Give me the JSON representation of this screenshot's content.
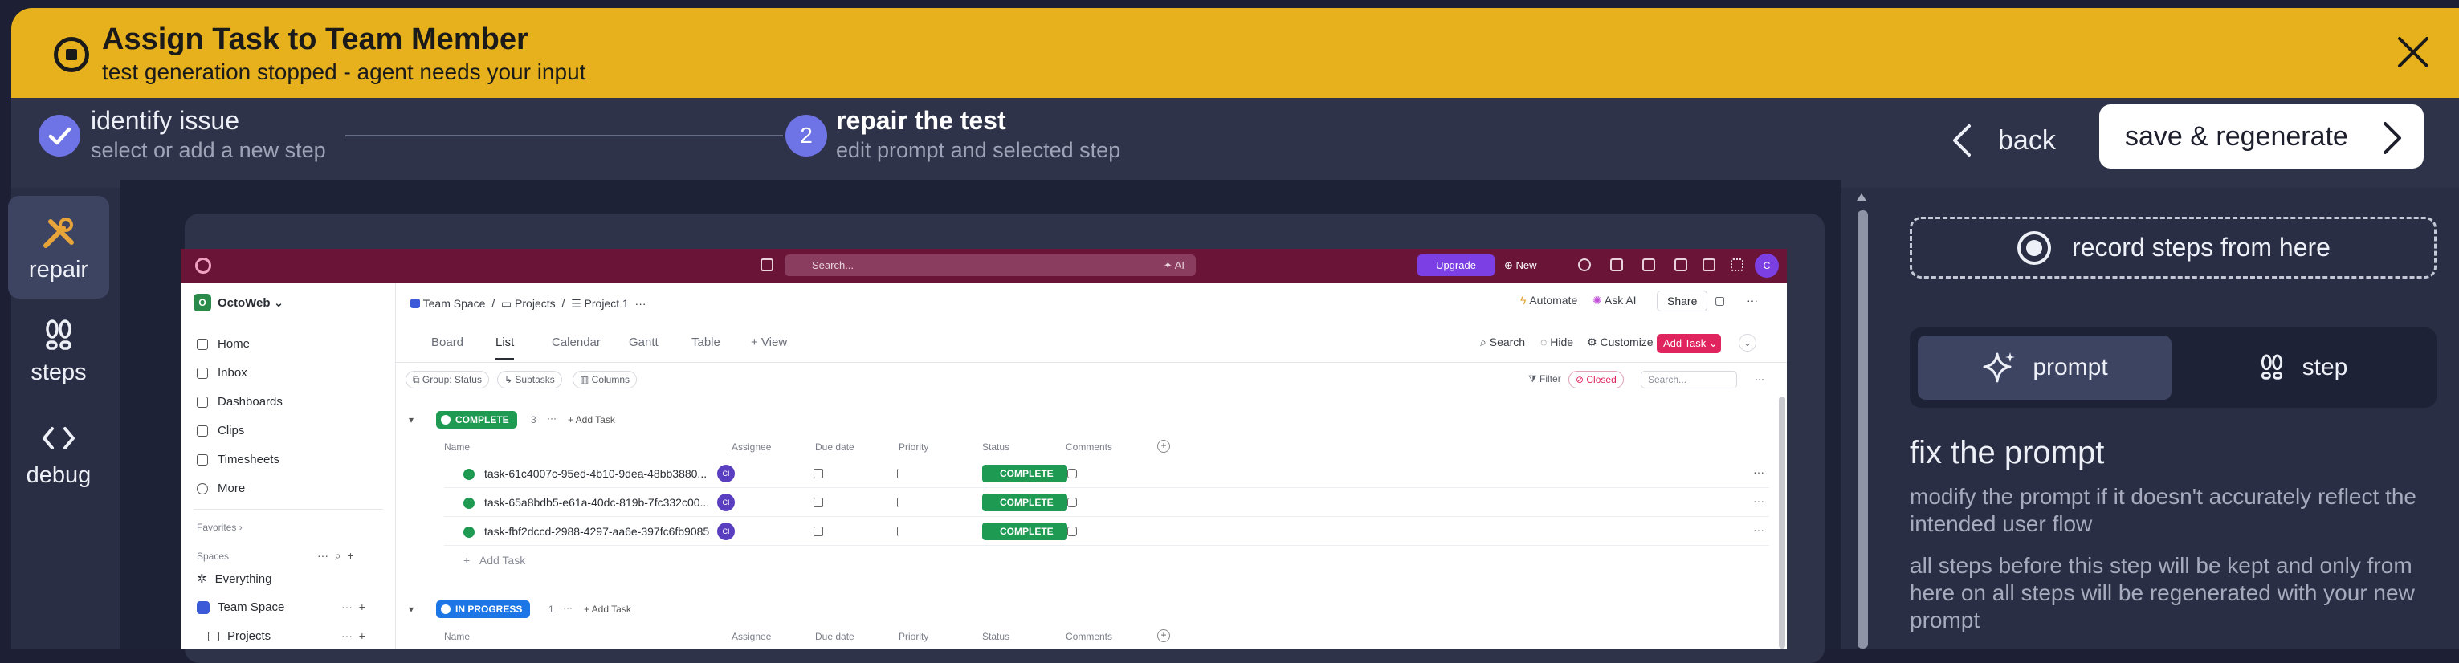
{
  "banner": {
    "title": "Assign Task to Team Member",
    "subtitle": "test generation stopped - agent needs your input"
  },
  "steps": {
    "step1": {
      "title": "identify issue",
      "subtitle": "select or add a new step"
    },
    "step2": {
      "number": "2",
      "title": "repair the test",
      "subtitle": "edit prompt and selected step"
    },
    "back_label": "back",
    "save_label": "save & regenerate"
  },
  "rail": {
    "items": [
      {
        "label": "repair",
        "active": true
      },
      {
        "label": "steps"
      },
      {
        "label": "debug"
      }
    ]
  },
  "preview": {
    "topbar": {
      "search": "Search...",
      "ai": "AI",
      "upgrade": "Upgrade",
      "new": "New",
      "avatar": "C"
    },
    "sidebar": {
      "workspace_badge": "O",
      "workspace": "OctoWeb",
      "nav": [
        "Home",
        "Inbox",
        "Dashboards",
        "Clips",
        "Timesheets",
        "More"
      ],
      "favorites": "Favorites",
      "spaces": "Spaces",
      "everything": "Everything",
      "team_space": "Team Space",
      "projects": "Projects"
    },
    "header": {
      "crumb1": "Team Space",
      "crumb2": "Projects",
      "crumb3": "Project 1",
      "automate": "Automate",
      "ask_ai": "Ask AI",
      "share": "Share"
    },
    "tabs": [
      "Board",
      "List",
      "Calendar",
      "Gantt",
      "Table",
      "+ View"
    ],
    "tools": {
      "search": "Search",
      "hide": "Hide",
      "customize": "Customize",
      "add_task": "Add Task"
    },
    "filters": {
      "group": "Group: Status",
      "subtasks": "Subtasks",
      "columns": "Columns",
      "filter": "Filter",
      "closed": "Closed",
      "search": "Search..."
    },
    "columns": [
      "Name",
      "Assignee",
      "Due date",
      "Priority",
      "Status",
      "Comments"
    ],
    "groups": [
      {
        "label": "COMPLETE",
        "count": "3",
        "add": "+ Add Task",
        "tasks": [
          {
            "name": "task-61c4007c-95ed-4b10-9dea-48bb3880...",
            "assignee": "CI",
            "status": "COMPLETE"
          },
          {
            "name": "task-65a8bdb5-e61a-40dc-819b-7fc332c00...",
            "assignee": "CI",
            "status": "COMPLETE"
          },
          {
            "name": "task-fbf2dccd-2988-4297-aa6e-397fc6fb9085",
            "assignee": "CI",
            "status": "COMPLETE"
          }
        ],
        "add_row": "Add Task"
      },
      {
        "label": "IN PROGRESS",
        "count": "1",
        "add": "+ Add Task"
      }
    ]
  },
  "panel": {
    "record_label": "record steps from here",
    "seg_prompt": "prompt",
    "seg_step": "step",
    "fix_title": "fix the prompt",
    "fix_p1": "modify the prompt if it doesn't accurately reflect the intended user flow",
    "fix_p2": "all steps before this step will be kept and only from here on all steps will be regenerated with your new prompt"
  },
  "colors": {
    "banner": "#e6b11c",
    "accent": "#6e74e6",
    "panel": "#2a2e44"
  }
}
